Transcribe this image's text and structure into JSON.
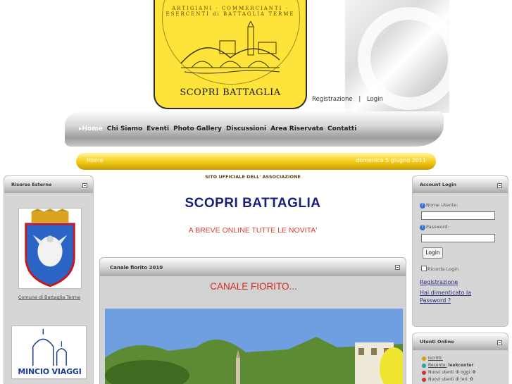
{
  "header": {
    "logo_ring_text": "ARTIGIANI · COMMERCIANTI · ESERCENTI di BATTAGLIA TERME",
    "logo_name": "SCOPRI   BATTAGLIA",
    "top_links": {
      "register": "Registrazione",
      "separator": "|",
      "login": "Login"
    }
  },
  "nav": {
    "items": [
      {
        "label": "▸Home",
        "active": true
      },
      {
        "label": "Chi Siamo"
      },
      {
        "label": "Eventi"
      },
      {
        "label": "Photo Gallery"
      },
      {
        "label": "Discussioni"
      },
      {
        "label": "Area Riservata"
      },
      {
        "label": "Contatti"
      }
    ]
  },
  "breadcrumb": {
    "crumb": "Home",
    "date": "domenica 5 giugno 2011"
  },
  "left_panel": {
    "title": "Risorse Esterne",
    "crest_label": "Comune di Battaglia Terme",
    "banner_text": "MINCIO VIAGGI"
  },
  "center": {
    "subtitle": "SITO UFFICIALE DELL' ASSOCIAZIONE",
    "title": "SCOPRI BATTAGLIA",
    "notice": "A BREVE ONLINE TUTTE LE NOVITA'"
  },
  "article": {
    "panel_title": "Canale fiorito 2010",
    "title": "CANALE FIORITO..."
  },
  "login_panel": {
    "title": "Account Login",
    "username_label": "Nome Utente:",
    "password_label": "Password:",
    "button": "Login",
    "remember": "Ricorda Login",
    "register_link": "Registrazione",
    "forgot_link": "Hai dimenticato la Password ?",
    "help_icon": "?"
  },
  "online_panel": {
    "title": "Utenti Online",
    "registered_label": "Iscritti:",
    "recent_label": "Recente:",
    "recent_user": "leekcenter",
    "new_today_label": "Nuovi utenti di oggi:",
    "new_today_count": "0",
    "new_yesterday_label": "Nuovi utenti di ieri:",
    "new_yesterday_count": "0"
  },
  "colors": {
    "logo_yellow": "#fde33a",
    "title_blue": "#1a1f7a",
    "notice_red": "#e23b2e",
    "panel_gray": "#d6d6d6"
  }
}
